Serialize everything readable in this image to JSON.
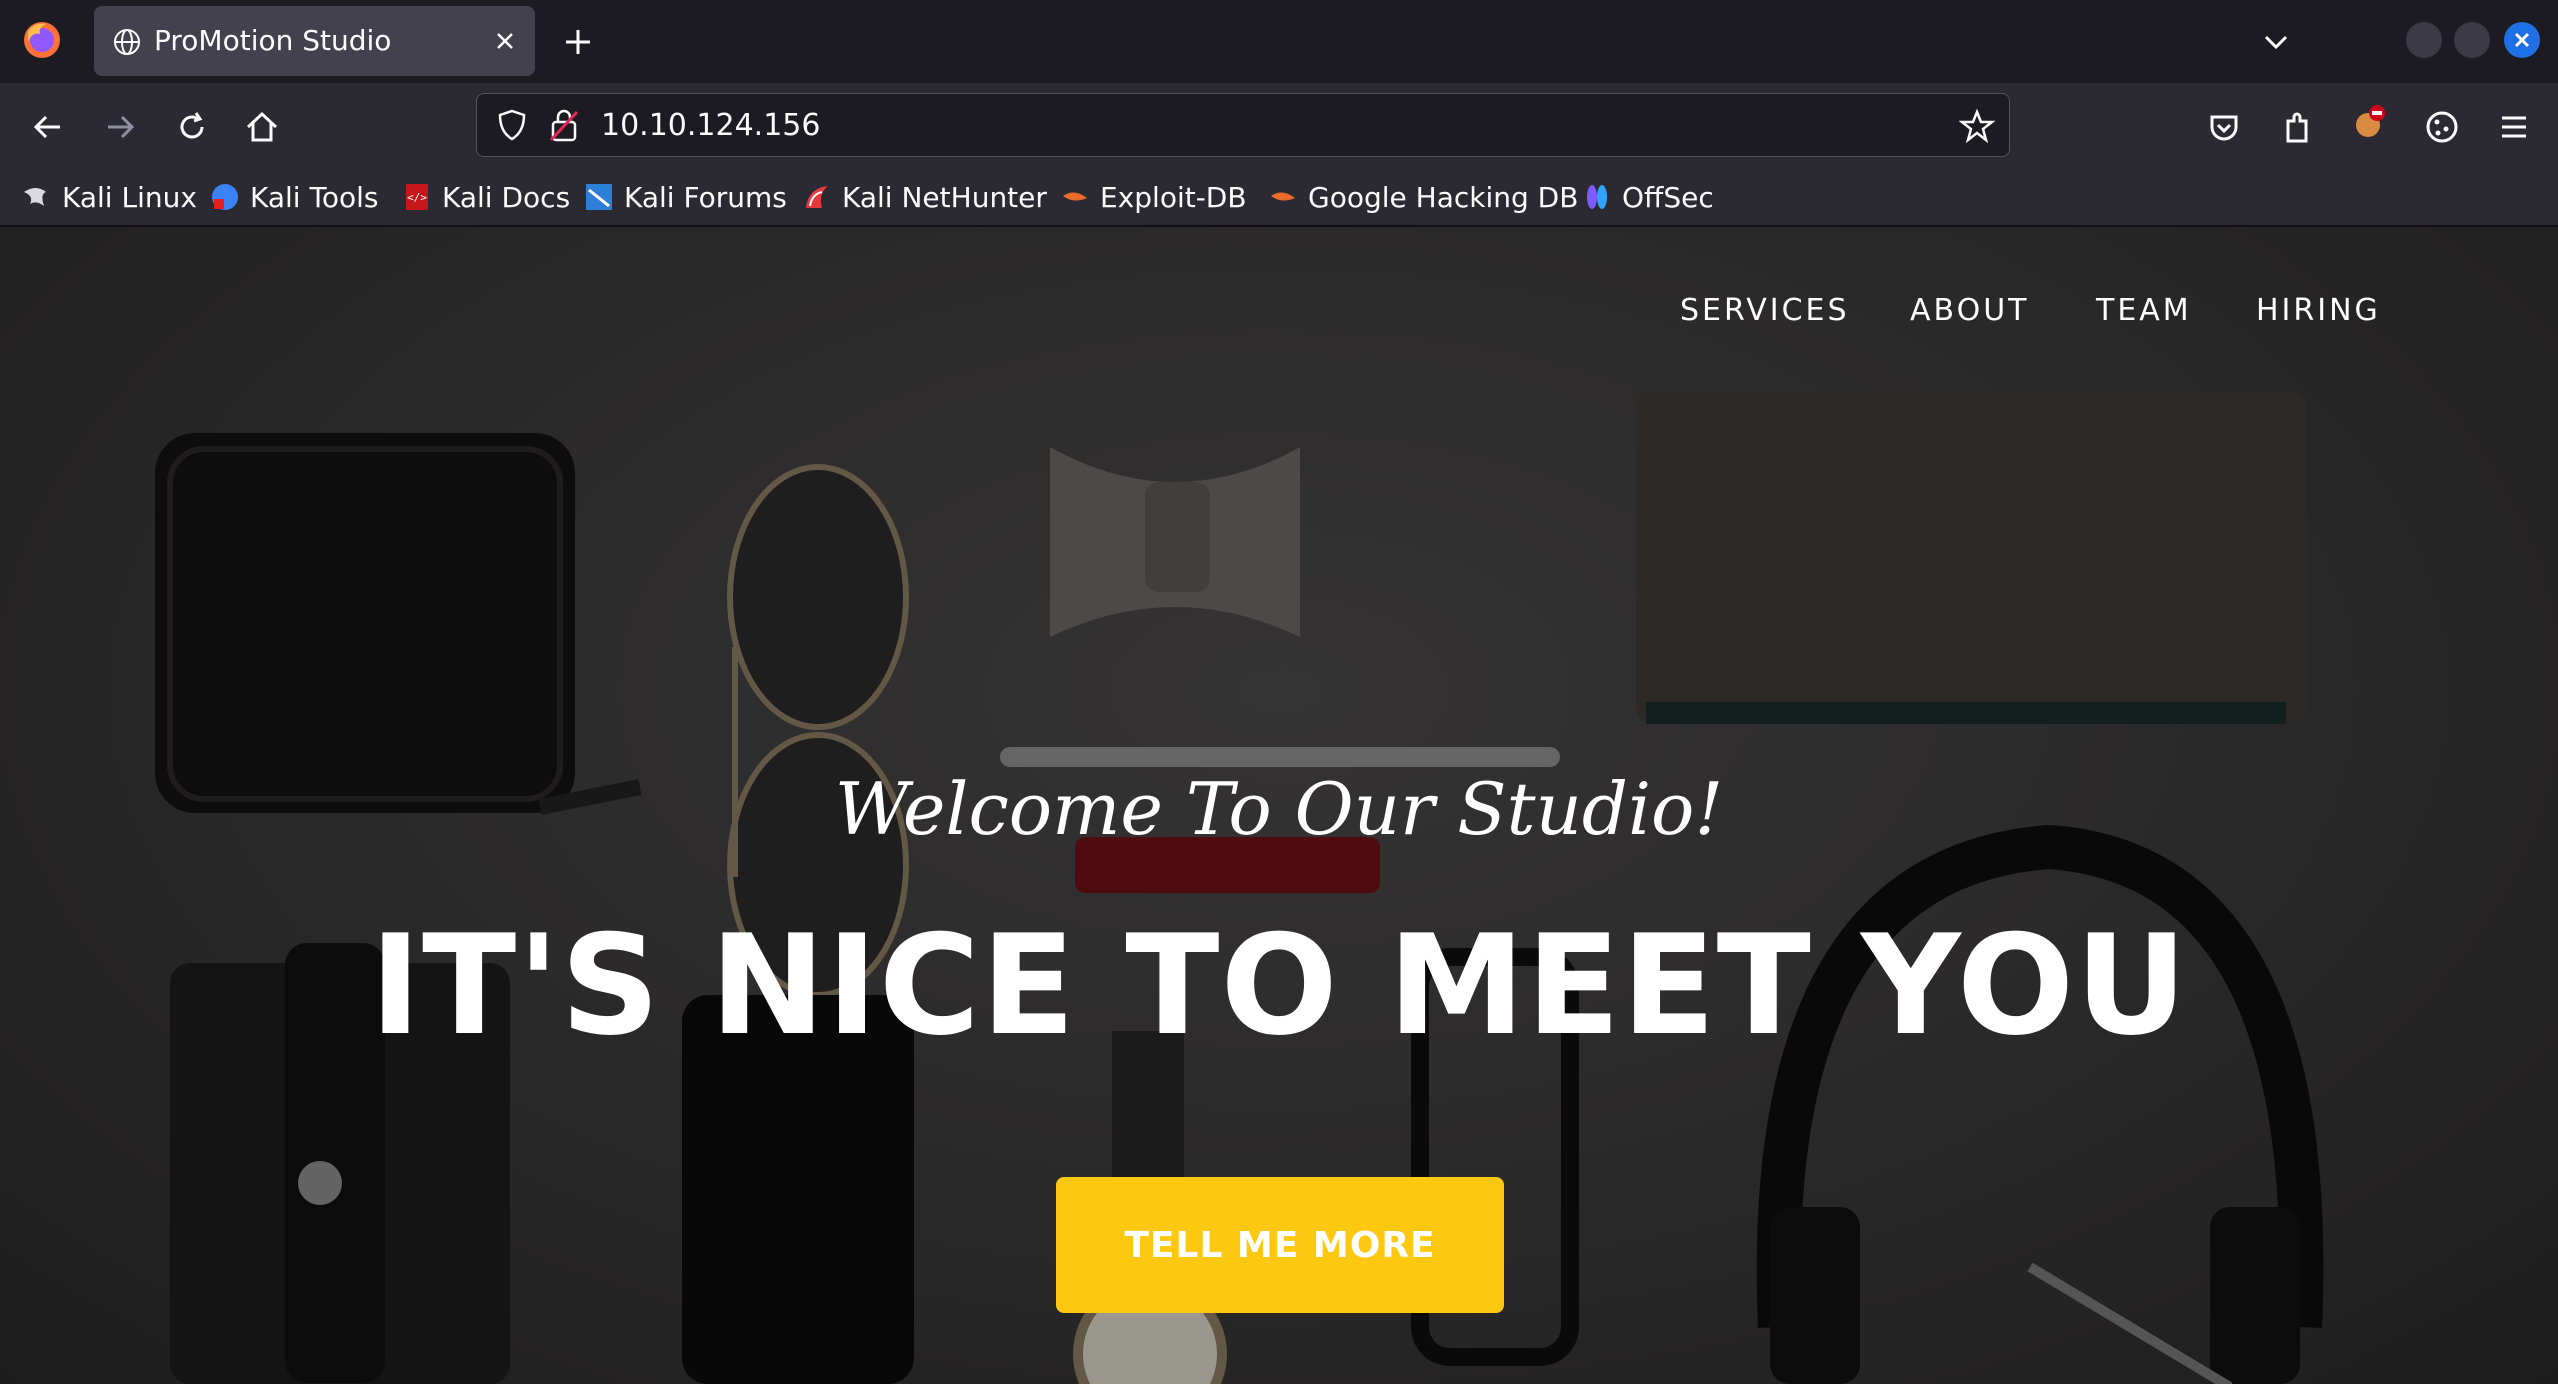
{
  "browser": {
    "tab_title": "ProMotion Studio",
    "url": "10.10.124.156",
    "bookmarks": [
      {
        "label": "Kali Linux",
        "icon": "kali-dragon-icon"
      },
      {
        "label": "Kali Tools",
        "icon": "kali-tools-icon"
      },
      {
        "label": "Kali Docs",
        "icon": "kali-docs-icon"
      },
      {
        "label": "Kali Forums",
        "icon": "kali-forums-icon"
      },
      {
        "label": "Kali NetHunter",
        "icon": "kali-nethunter-icon"
      },
      {
        "label": "Exploit-DB",
        "icon": "exploit-db-icon"
      },
      {
        "label": "Google Hacking DB",
        "icon": "ghdb-icon"
      },
      {
        "label": "OffSec",
        "icon": "offsec-icon"
      }
    ]
  },
  "site": {
    "nav": [
      "SERVICES",
      "ABOUT",
      "TEAM",
      "HIRING"
    ],
    "welcome": "Welcome To Our Studio!",
    "heading": "IT'S NICE TO MEET YOU",
    "cta": "TELL ME MORE"
  },
  "colors": {
    "accent": "#fec810",
    "chrome_dark": "#1c1b22",
    "chrome": "#2b2a33",
    "tab_active": "#42414d",
    "close_button": "#1f6fe5"
  }
}
